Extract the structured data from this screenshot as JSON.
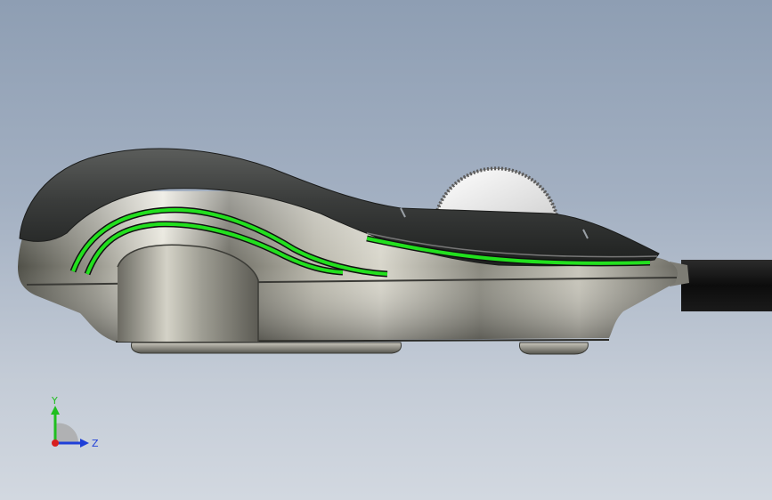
{
  "viewport": {
    "background_top": "#8e9eb3",
    "background_bottom": "#d2d8e0"
  },
  "model": {
    "shell_color": "#4a4c4a",
    "body_color": "#8d8c83",
    "accent_color": "#22e01e",
    "cable_color": "#101010",
    "wheel_color": "#f2f2f2"
  },
  "triad": {
    "y_label": "Y",
    "z_label": "Z",
    "y_color": "#1fbf1f",
    "z_color": "#1f3fd8",
    "x_color": "#d81f1f"
  }
}
